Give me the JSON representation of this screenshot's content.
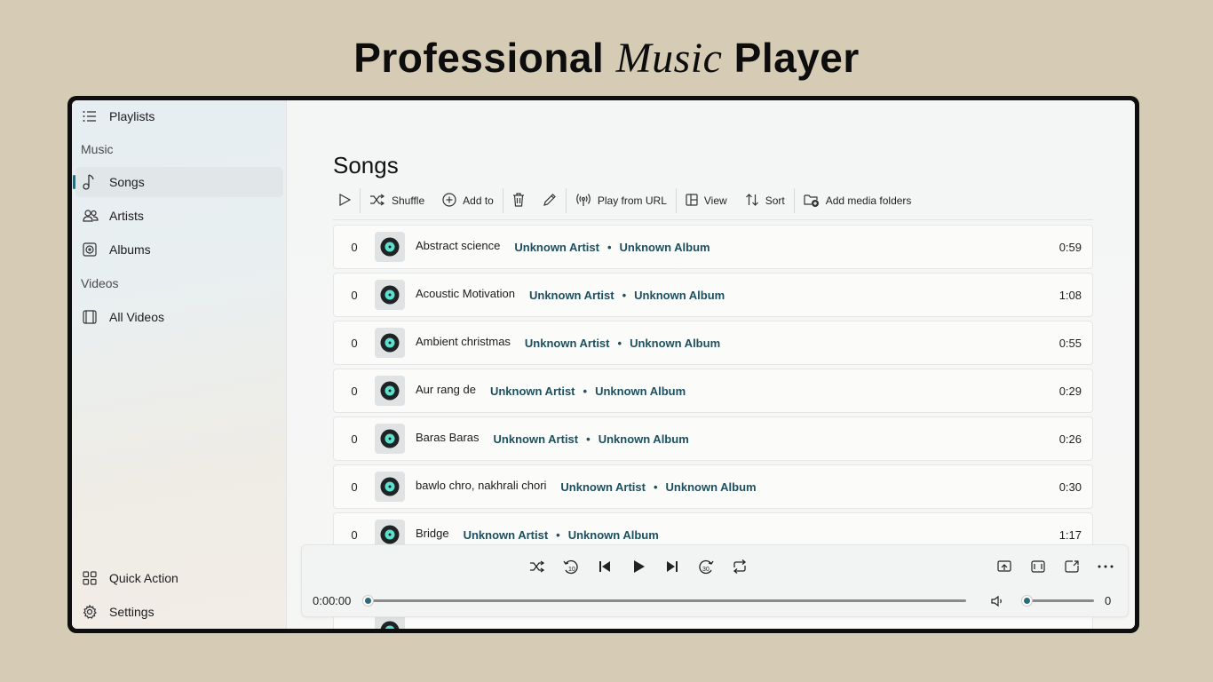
{
  "banner": {
    "part1": "Professional",
    "part2": "Music",
    "part3": "Player"
  },
  "sidebar": {
    "playlists": "Playlists",
    "music_header": "Music",
    "songs": "Songs",
    "artists": "Artists",
    "albums": "Albums",
    "videos_header": "Videos",
    "all_videos": "All Videos",
    "quick_action": "Quick Action",
    "settings": "Settings"
  },
  "main": {
    "title": "Songs",
    "toolbar": {
      "shuffle": "Shuffle",
      "add_to": "Add to",
      "play_from_url": "Play from URL",
      "view": "View",
      "sort": "Sort",
      "add_media_folders": "Add media folders"
    }
  },
  "songs": [
    {
      "num": "0",
      "title": "Abstract science",
      "artist": "Unknown Artist",
      "album": "Unknown Album",
      "duration": "0:59"
    },
    {
      "num": "0",
      "title": "Acoustic Motivation",
      "artist": "Unknown Artist",
      "album": "Unknown Album",
      "duration": "1:08"
    },
    {
      "num": "0",
      "title": "Ambient christmas",
      "artist": "Unknown Artist",
      "album": "Unknown Album",
      "duration": "0:55"
    },
    {
      "num": "0",
      "title": "Aur rang de",
      "artist": "Unknown Artist",
      "album": "Unknown Album",
      "duration": "0:29"
    },
    {
      "num": "0",
      "title": "Baras Baras",
      "artist": "Unknown Artist",
      "album": "Unknown Album",
      "duration": "0:26"
    },
    {
      "num": "0",
      "title": "bawlo chro, nakhrali chori",
      "artist": "Unknown Artist",
      "album": "Unknown Album",
      "duration": "0:30"
    },
    {
      "num": "0",
      "title": "Bridge",
      "artist": "Unknown Artist",
      "album": "Unknown Album",
      "duration": "1:17"
    }
  ],
  "player": {
    "current_time": "0:00:00",
    "progress": 0,
    "volume_value": "0",
    "volume_level": 0
  },
  "colors": {
    "accent": "#2a6b7a",
    "link": "#1e4f5e",
    "background": "#d6ccb6"
  }
}
